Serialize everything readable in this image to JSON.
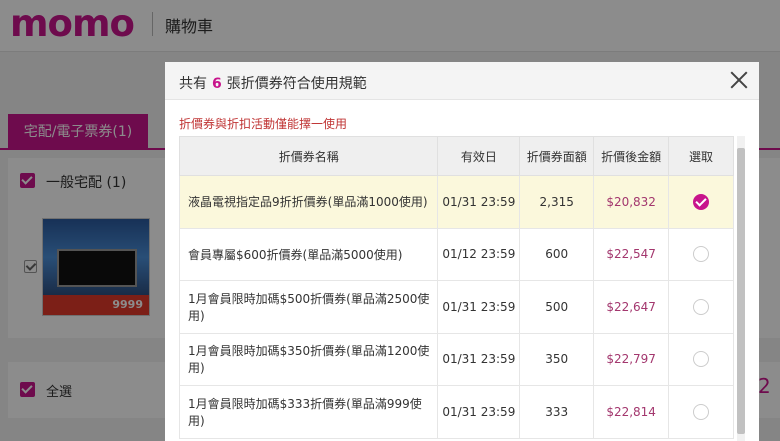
{
  "header": {
    "logo": "momo",
    "page_title": "購物車"
  },
  "tabs": {
    "active_label": "宅配/電子票券(1)"
  },
  "section": {
    "title": "一般宅配 (1)"
  },
  "product": {
    "banner_price": "9999"
  },
  "footer": {
    "select_all_label": "全選",
    "partial_digit": "2"
  },
  "modal": {
    "title_prefix": "共有",
    "title_count": "6",
    "title_suffix": "張折價券符合使用規範",
    "notice": "折價券與折扣活動僅能擇一使用",
    "columns": [
      "折價券名稱",
      "有效日",
      "折價券面額",
      "折價後金額",
      "選取"
    ],
    "coupons": [
      {
        "name": "液晶電視指定品9折折價券(單品滿1000使用)",
        "expiry": "01/31 23:59",
        "amount": "2,315",
        "after": "$20,832",
        "selected": true
      },
      {
        "name": "會員專屬$600折價券(單品滿5000使用)",
        "expiry": "01/12 23:59",
        "amount": "600",
        "after": "$22,547",
        "selected": false
      },
      {
        "name": "1月會員限時加碼$500折價券(單品滿2500使用)",
        "expiry": "01/31 23:59",
        "amount": "500",
        "after": "$22,647",
        "selected": false
      },
      {
        "name": "1月會員限時加碼$350折價券(單品滿1200使用)",
        "expiry": "01/31 23:59",
        "amount": "350",
        "after": "$22,797",
        "selected": false
      },
      {
        "name": "1月會員限時加碼$333折價券(單品滿999使用)",
        "expiry": "01/31 23:59",
        "amount": "333",
        "after": "$22,814",
        "selected": false
      }
    ]
  },
  "colors": {
    "brand": "#c8148c",
    "notice": "#c03535",
    "selected_row": "#fbf8dc",
    "price": "#a3376e"
  }
}
